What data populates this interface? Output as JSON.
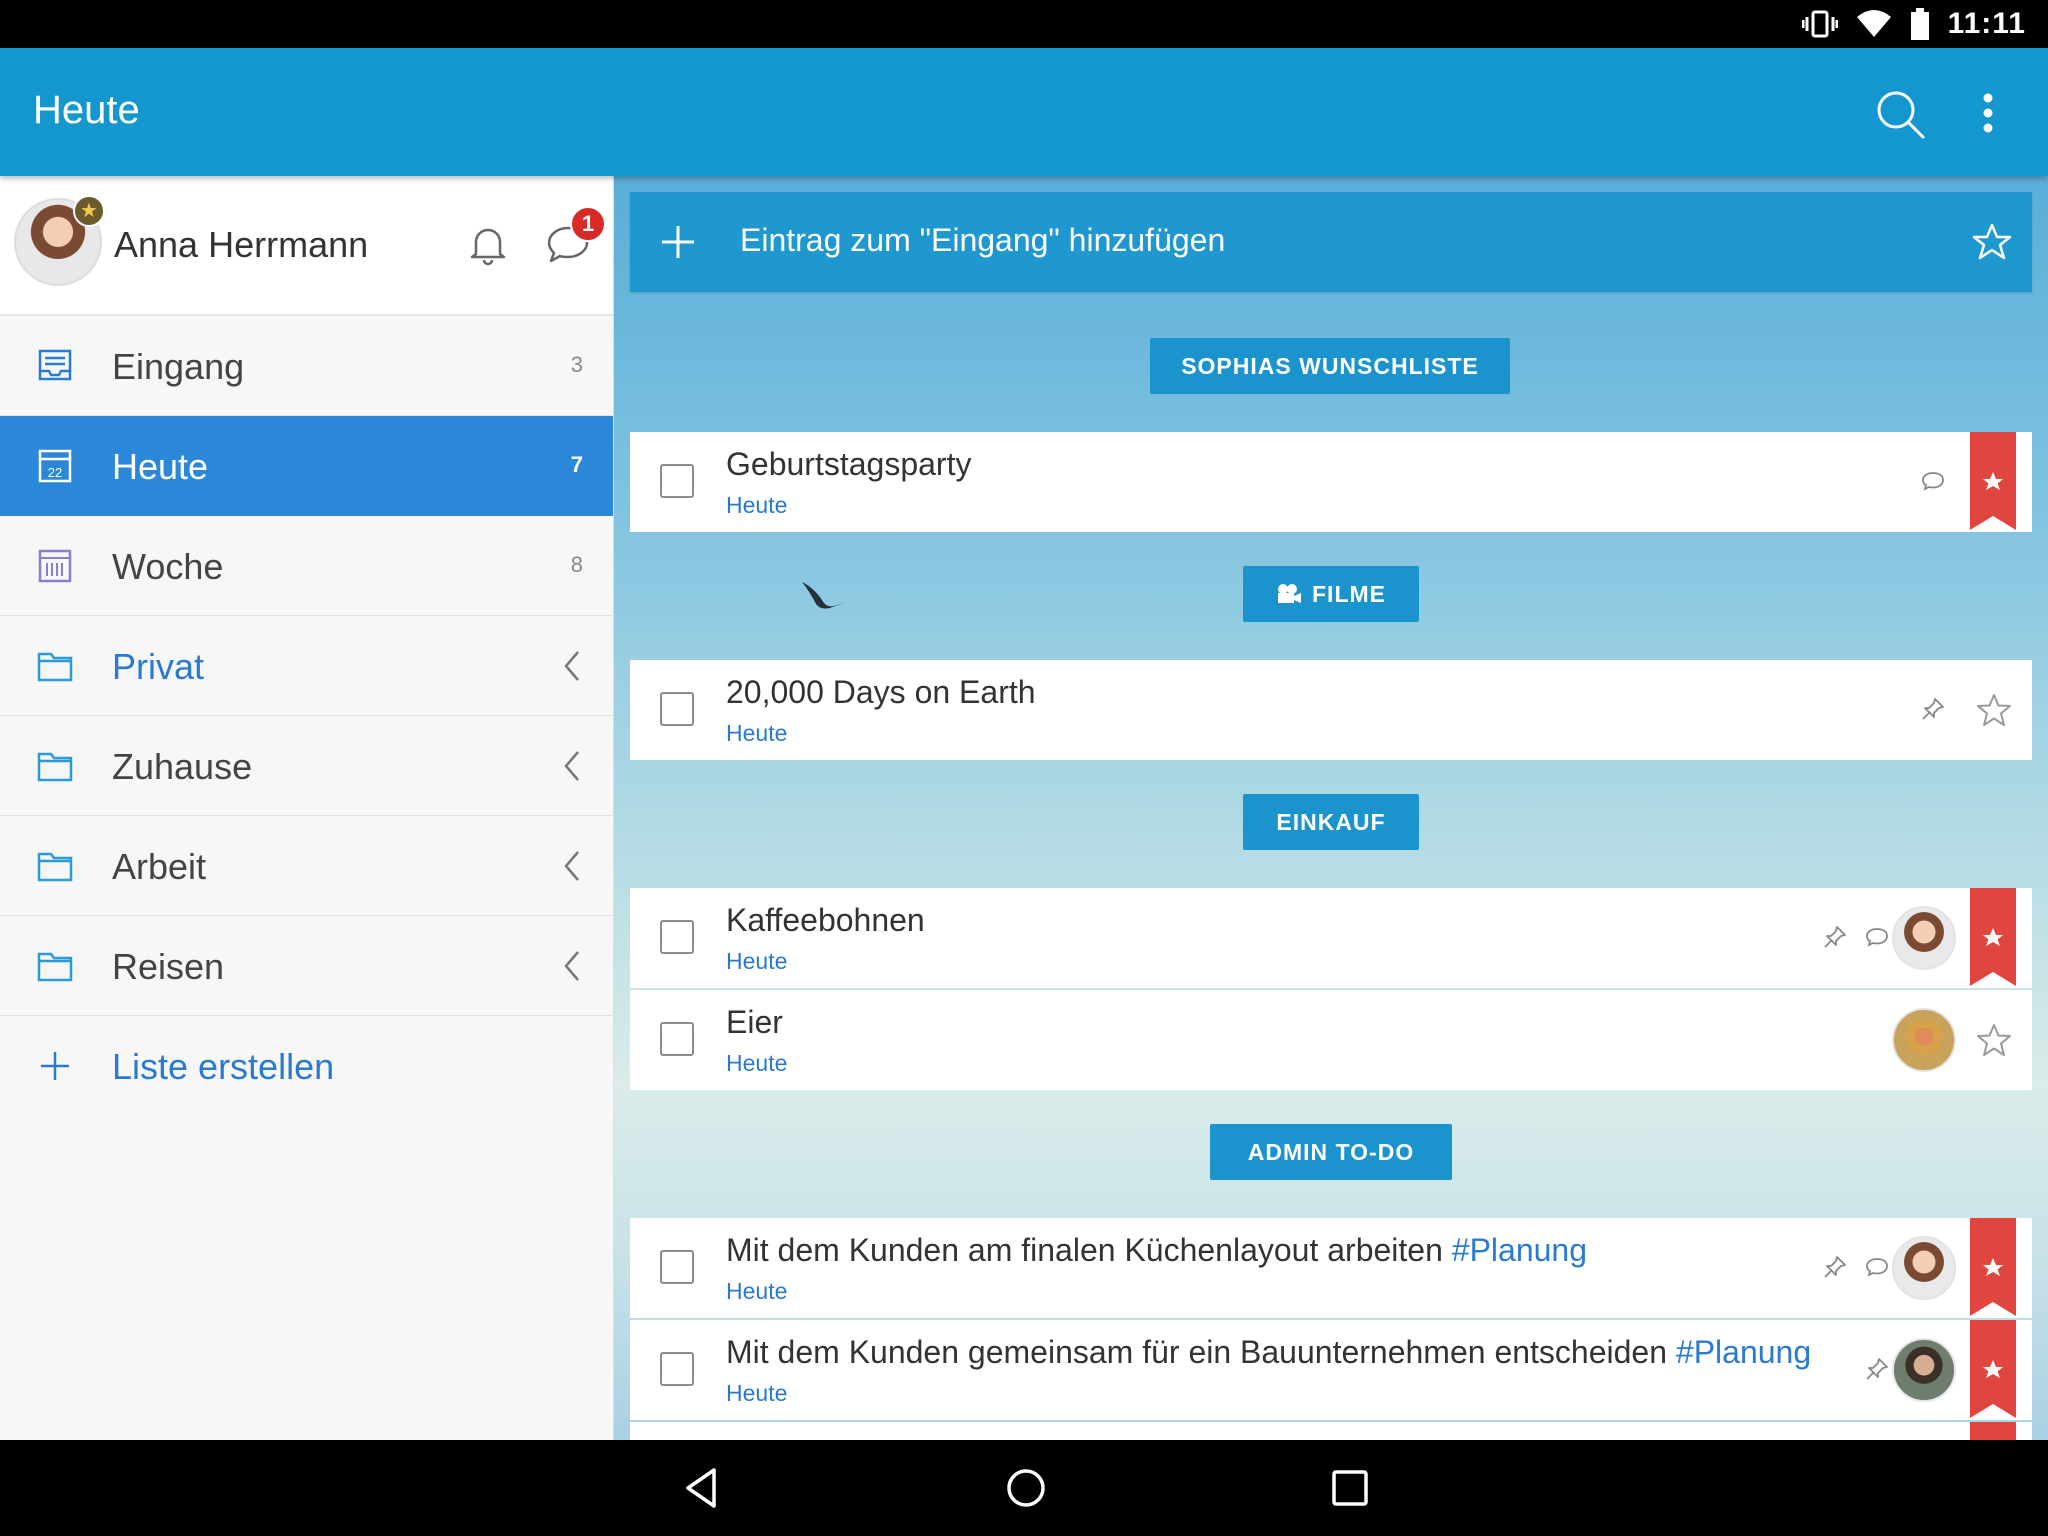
{
  "status_bar": {
    "time": "11:11"
  },
  "app_bar": {
    "title": "Heute"
  },
  "profile": {
    "name": "Anna Herrmann",
    "notification_badge": "1"
  },
  "sidebar": {
    "items": [
      {
        "label": "Eingang",
        "count": "3"
      },
      {
        "label": "Heute",
        "count": "7"
      },
      {
        "label": "Woche",
        "count": "8"
      },
      {
        "label": "Privat"
      },
      {
        "label": "Zuhause"
      },
      {
        "label": "Arbeit"
      },
      {
        "label": "Reisen"
      }
    ],
    "create_label": "Liste erstellen"
  },
  "add_bar": {
    "text": "Eintrag zum \"Eingang\" hinzufügen"
  },
  "sections": [
    {
      "label": "SOPHIAS WUNSCHLISTE"
    },
    {
      "label": "FILME"
    },
    {
      "label": "EINKAUF"
    },
    {
      "label": "ADMIN TO-DO"
    }
  ],
  "tasks": [
    {
      "title": "Geburtstagsparty",
      "due": "Heute",
      "starred": true
    },
    {
      "title": "20,000 Days on Earth",
      "due": "Heute",
      "starred": false
    },
    {
      "title": "Kaffeebohnen",
      "due": "Heute",
      "starred": true
    },
    {
      "title": "Eier",
      "due": "Heute",
      "starred": false
    },
    {
      "title": "Mit dem Kunden am finalen Küchenlayout arbeiten",
      "tag": "#Planung",
      "due": "Heute",
      "starred": true
    },
    {
      "title": "Mit dem Kunden gemeinsam für ein Bauunternehmen entscheiden",
      "tag": "#Planung",
      "due": "Heute",
      "starred": true
    }
  ],
  "colors": {
    "app_bar": "#1497cf",
    "active_item": "#2b88d9",
    "link": "#2b7ad2",
    "ribbon": "#e0463f",
    "badge": "#d62b27"
  }
}
